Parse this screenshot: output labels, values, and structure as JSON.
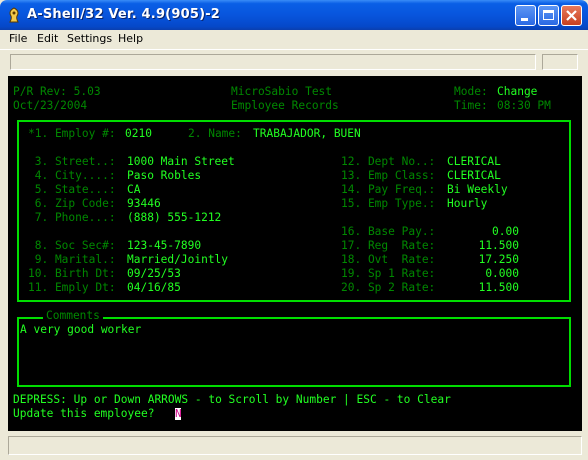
{
  "window": {
    "title": "A-Shell/32 Ver. 4.9(905)-2"
  },
  "menu": [
    {
      "label": "File"
    },
    {
      "label": "Edit"
    },
    {
      "label": "Settings"
    },
    {
      "label": "Help"
    }
  ],
  "header": {
    "pr_rev": "P/R Rev: 5.03",
    "date": "Oct/23/2004",
    "company": "MicroSabio Test",
    "subtitle": "Employee Records",
    "mode_label": "Mode:",
    "mode_value": "Change",
    "time_label": "Time:",
    "time_value": "08:30 PM"
  },
  "form": {
    "employ_no": {
      "label": "*1. Employ #:",
      "value": "0210"
    },
    "name": {
      "label": "2. Name:",
      "value": "TRABAJADOR, BUEN"
    },
    "left_fields": [
      {
        "label": " 3. Street..:",
        "value": "1000 Main Street"
      },
      {
        "label": " 4. City....:",
        "value": "Paso Robles"
      },
      {
        "label": " 5. State...:",
        "value": "CA"
      },
      {
        "label": " 6. Zip Code:",
        "value": "93446"
      },
      {
        "label": " 7. Phone...:",
        "value": "(888) 555-1212"
      },
      {
        "label": " 8. Soc Sec#:",
        "value": "123-45-7890"
      },
      {
        "label": " 9. Marital.:",
        "value": "Married/Jointly"
      },
      {
        "label": "10. Birth Dt:",
        "value": "09/25/53"
      },
      {
        "label": "11. Emply Dt:",
        "value": "04/16/85"
      }
    ],
    "right_fields": [
      {
        "label": "12. Dept No..:",
        "value": "CLERICAL"
      },
      {
        "label": "13. Emp Class:",
        "value": "CLERICAL"
      },
      {
        "label": "14. Pay Freq.:",
        "value": "Bi Weekly"
      },
      {
        "label": "15. Emp Type.:",
        "value": "Hourly"
      }
    ],
    "pay_fields": [
      {
        "label": "16. Base Pay.:",
        "value": "0.00"
      },
      {
        "label": "17. Reg  Rate:",
        "value": "11.500"
      },
      {
        "label": "18. Ovt  Rate:",
        "value": "17.250"
      },
      {
        "label": "19. Sp 1 Rate:",
        "value": "0.000"
      },
      {
        "label": "20. Sp 2 Rate:",
        "value": "11.500"
      }
    ]
  },
  "comments": {
    "legend": "Comments",
    "text": "A very good worker"
  },
  "footer": {
    "hint": "DEPRESS: Up or Down ARROWS - to Scroll by Number | ESC - to Clear",
    "prompt": "Update this employee?",
    "cursor_char": "N"
  },
  "colors": {
    "terminal_bg": "#000000",
    "label_green": "#008800",
    "value_green": "#22ff22",
    "border_green": "#00dd00"
  }
}
